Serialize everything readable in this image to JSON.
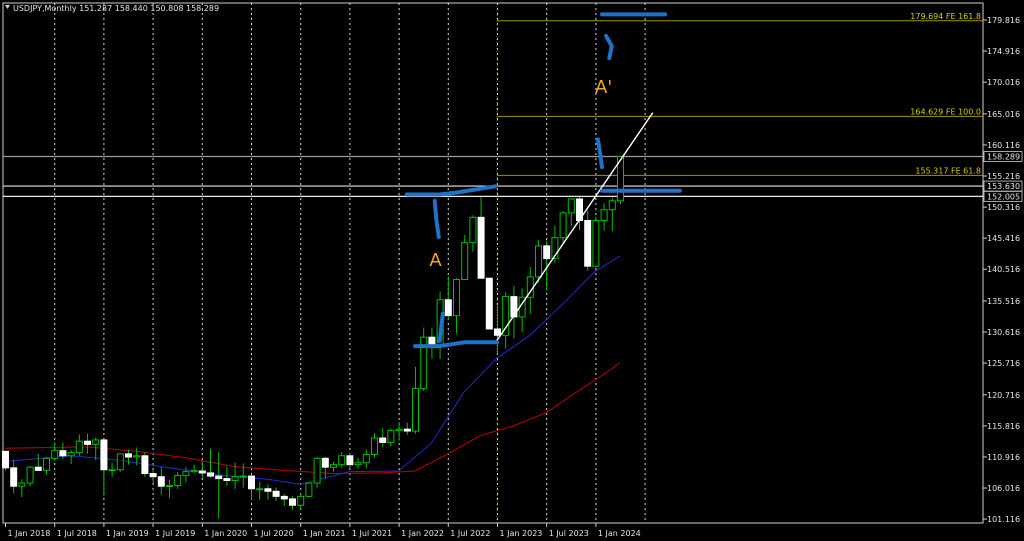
{
  "chart_data": {
    "type": "candlestick",
    "title": "USDJPY,Monthly  151.287 158.440 150.808 158.289",
    "x_labels": [
      "1 Jan 2018",
      "1 Jul 2018",
      "1 Jan 2019",
      "1 Jul 2019",
      "1 Jan 2020",
      "1 Jul 2020",
      "1 Jan 2021",
      "1 Jul 2021",
      "1 Jan 2022",
      "1 Jul 2022",
      "1 Jan 2023",
      "1 Jul 2023",
      "1 Jan 2024"
    ],
    "y_ticks": [
      "179.816",
      "174.916",
      "170.016",
      "165.016",
      "160.116",
      "155.216",
      "150.316",
      "145.416",
      "140.516",
      "135.516",
      "130.616",
      "125.716",
      "120.716",
      "115.816",
      "110.916",
      "106.016",
      "101.116"
    ],
    "ylim": [
      100.5,
      182.5
    ],
    "candles": [
      [
        111.8,
        111.9,
        108.8,
        109.2
      ],
      [
        109.2,
        110.5,
        105.2,
        106.3
      ],
      [
        106.3,
        107.4,
        104.6,
        106.8
      ],
      [
        106.8,
        109.5,
        106.3,
        109.3
      ],
      [
        109.3,
        111.4,
        108.9,
        108.8
      ],
      [
        108.8,
        110.9,
        108.1,
        110.7
      ],
      [
        110.7,
        113.2,
        110.3,
        111.9
      ],
      [
        111.9,
        113.2,
        110.6,
        111.1
      ],
      [
        111.1,
        112.0,
        109.8,
        111.6
      ],
      [
        111.6,
        114.5,
        111.1,
        113.4
      ],
      [
        113.4,
        114.6,
        111.4,
        112.9
      ],
      [
        112.9,
        114.0,
        110.4,
        113.6
      ],
      [
        113.6,
        113.7,
        104.8,
        108.9
      ],
      [
        108.9,
        110.0,
        107.8,
        108.9
      ],
      [
        108.9,
        111.3,
        108.6,
        111.4
      ],
      [
        111.4,
        112.1,
        109.7,
        110.9
      ],
      [
        110.9,
        112.4,
        109.6,
        111.1
      ],
      [
        111.1,
        111.7,
        107.8,
        108.3
      ],
      [
        108.3,
        108.9,
        106.8,
        107.8
      ],
      [
        107.8,
        109.3,
        105.0,
        106.3
      ],
      [
        106.3,
        107.3,
        104.4,
        106.4
      ],
      [
        106.4,
        108.5,
        105.9,
        108.0
      ],
      [
        108.0,
        109.3,
        106.9,
        108.6
      ],
      [
        108.6,
        109.7,
        108.4,
        108.8
      ],
      [
        108.7,
        110.3,
        107.7,
        108.4
      ],
      [
        108.4,
        112.2,
        107.6,
        107.9
      ],
      [
        107.9,
        111.7,
        101.2,
        107.5
      ],
      [
        107.5,
        109.4,
        106.4,
        107.2
      ],
      [
        107.2,
        110.0,
        105.9,
        107.8
      ],
      [
        107.8,
        109.9,
        106.1,
        107.9
      ],
      [
        107.9,
        108.2,
        104.2,
        105.9
      ],
      [
        105.9,
        107.0,
        104.2,
        105.9
      ],
      [
        105.9,
        106.6,
        104.2,
        105.5
      ],
      [
        105.5,
        106.1,
        104.0,
        104.7
      ],
      [
        104.7,
        105.1,
        103.2,
        104.3
      ],
      [
        104.3,
        104.7,
        102.6,
        103.3
      ],
      [
        103.3,
        105.1,
        102.6,
        104.7
      ],
      [
        104.7,
        106.8,
        104.5,
        106.8
      ],
      [
        106.8,
        110.9,
        106.1,
        110.7
      ],
      [
        110.7,
        110.9,
        107.5,
        109.3
      ],
      [
        109.3,
        110.2,
        108.6,
        109.7
      ],
      [
        109.7,
        111.7,
        109.2,
        111.1
      ],
      [
        111.1,
        111.6,
        109.1,
        109.7
      ],
      [
        109.7,
        110.8,
        109.1,
        110.0
      ],
      [
        110.0,
        112.1,
        109.1,
        111.3
      ],
      [
        111.3,
        114.7,
        110.8,
        113.9
      ],
      [
        113.9,
        115.5,
        112.5,
        113.2
      ],
      [
        113.2,
        115.4,
        112.6,
        115.1
      ],
      [
        115.1,
        116.4,
        113.5,
        115.3
      ],
      [
        115.3,
        116.3,
        114.4,
        115.0
      ],
      [
        115.0,
        125.1,
        114.6,
        121.7
      ],
      [
        121.7,
        131.3,
        121.3,
        129.8
      ],
      [
        129.8,
        131.3,
        126.4,
        128.5
      ],
      [
        128.5,
        137.0,
        126.4,
        135.7
      ],
      [
        135.7,
        139.4,
        132.5,
        133.2
      ],
      [
        133.2,
        139.1,
        130.4,
        138.9
      ],
      [
        138.9,
        145.9,
        138.9,
        144.7
      ],
      [
        144.7,
        149.0,
        143.3,
        148.7
      ],
      [
        148.7,
        151.9,
        145.1,
        139.1
      ],
      [
        139.1,
        138.2,
        133.6,
        131.1
      ],
      [
        131.1,
        134.8,
        127.2,
        130.1
      ],
      [
        130.1,
        136.9,
        128.0,
        136.2
      ],
      [
        136.2,
        137.9,
        129.6,
        133.0
      ],
      [
        133.0,
        137.5,
        130.6,
        136.1
      ],
      [
        136.1,
        140.9,
        133.5,
        139.3
      ],
      [
        139.3,
        145.1,
        138.4,
        144.2
      ],
      [
        144.2,
        145.0,
        137.2,
        142.2
      ],
      [
        142.2,
        147.4,
        141.5,
        145.5
      ],
      [
        145.5,
        149.7,
        144.6,
        149.4
      ],
      [
        149.4,
        151.7,
        147.3,
        151.6
      ],
      [
        151.6,
        151.9,
        146.7,
        148.2
      ],
      [
        148.2,
        149.8,
        140.3,
        141.0
      ],
      [
        141.0,
        148.8,
        140.8,
        148.2
      ],
      [
        148.2,
        150.9,
        146.6,
        149.9
      ],
      [
        149.9,
        151.8,
        146.5,
        151.3
      ],
      [
        151.3,
        158.4,
        150.8,
        158.3
      ]
    ],
    "moving_averages": [
      {
        "name": "",
        "color": "#1f2ccf",
        "points": [
          [
            0,
            110.2
          ],
          [
            8,
            111.1
          ],
          [
            14,
            110.4
          ],
          [
            20,
            109.2
          ],
          [
            26,
            108.1
          ],
          [
            32,
            107.4
          ],
          [
            36,
            106.6
          ],
          [
            42,
            108.6
          ],
          [
            48,
            108.7
          ],
          [
            52,
            113.1
          ],
          [
            56,
            121.2
          ],
          [
            60,
            126.5
          ],
          [
            64,
            130.1
          ],
          [
            68,
            135.0
          ],
          [
            72,
            140.2
          ],
          [
            75,
            142.6
          ]
        ]
      },
      {
        "name": "",
        "color": "#c40000",
        "points": [
          [
            0,
            112.3
          ],
          [
            10,
            112.5
          ],
          [
            16,
            111.8
          ],
          [
            22,
            110.8
          ],
          [
            28,
            109.4
          ],
          [
            34,
            108.8
          ],
          [
            40,
            108.3
          ],
          [
            46,
            108.4
          ],
          [
            50,
            108.7
          ],
          [
            54,
            111.4
          ],
          [
            58,
            114.3
          ],
          [
            62,
            115.8
          ],
          [
            66,
            117.9
          ],
          [
            70,
            121.4
          ],
          [
            74,
            124.8
          ],
          [
            75,
            125.8
          ]
        ]
      }
    ],
    "horizontal_lines": [
      {
        "value": 158.289,
        "label": "158.289",
        "color": "#9c9c9c"
      },
      {
        "value": 153.63,
        "label": "153.630",
        "color": "#e6e6e6"
      },
      {
        "value": 152.005,
        "label": "152.005",
        "color": "#e6e6e6"
      }
    ],
    "fibonacci_levels": [
      {
        "value": 179.694,
        "label": "179.694 FE 161.8"
      },
      {
        "value": 164.629,
        "label": "164.629 FE 100.0"
      },
      {
        "value": 155.317,
        "label": "155.317 FE 61.8"
      }
    ],
    "fib_start_index": 60,
    "trendline": [
      [
        60,
        129.3
      ],
      [
        79,
        165.2
      ]
    ],
    "drawings": [
      {
        "color": "#1e73c8",
        "points": [
          [
            60,
            129.0
          ],
          [
            56,
            129.0
          ],
          [
            53,
            128.4
          ],
          [
            50,
            128.4
          ]
        ]
      },
      {
        "color": "#1e73c8",
        "points": [
          [
            53,
            129.2
          ],
          [
            53.4,
            133.5
          ]
        ]
      },
      {
        "color": "#1e73c8",
        "points": [
          [
            49,
            152.3
          ],
          [
            53,
            152.3
          ],
          [
            55,
            152.6
          ],
          [
            59.8,
            153.6
          ]
        ]
      },
      {
        "color": "#1e73c8",
        "points": [
          [
            52.4,
            151.3
          ],
          [
            52.6,
            148.4
          ],
          [
            52.9,
            145.6
          ]
        ]
      },
      {
        "color": "#1e73c8",
        "points": [
          [
            72.8,
            152.9
          ],
          [
            82.3,
            152.9
          ]
        ]
      },
      {
        "color": "#1e73c8",
        "points": [
          [
            72.3,
            161.0
          ],
          [
            72.5,
            159.4
          ],
          [
            72.8,
            156.6
          ]
        ]
      },
      {
        "color": "#1e73c8",
        "points": [
          [
            73.3,
            177.3
          ],
          [
            74.0,
            175.7
          ],
          [
            73.7,
            173.8
          ]
        ]
      },
      {
        "color": "#1e73c8",
        "points": [
          [
            72.8,
            180.7
          ],
          [
            80.5,
            180.7
          ]
        ]
      }
    ],
    "annotations": [
      {
        "text": "A",
        "x": 52.5,
        "y": 141.0,
        "color": "#f2a81b"
      },
      {
        "text": "A'",
        "x": 73.0,
        "y": 168.3,
        "color": "#f2a81b"
      }
    ]
  }
}
